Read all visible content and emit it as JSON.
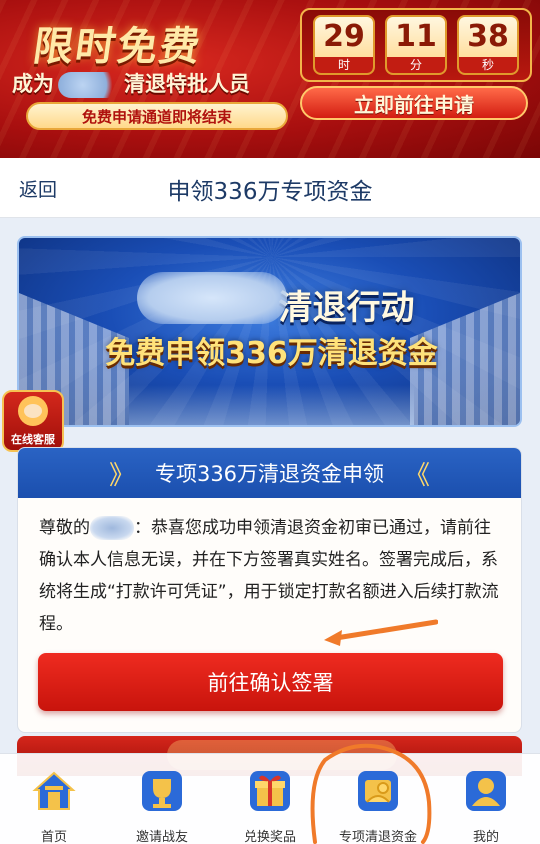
{
  "promo": {
    "title": "限时免费",
    "subtitle_prefix": "成为",
    "subtitle_suffix": "清退特批人员",
    "pill": "免费申请通道即将结束",
    "countdown": [
      {
        "value": "29",
        "unit": "时"
      },
      {
        "value": "11",
        "unit": "分"
      },
      {
        "value": "38",
        "unit": "秒"
      }
    ],
    "cta": "立即前往申请"
  },
  "nav": {
    "back": "返回",
    "title": "申领336万专项资金"
  },
  "hero": {
    "line1": "清退行动",
    "line2": "免费申领336万清退资金"
  },
  "service": {
    "label": "在线客服"
  },
  "card": {
    "title": "专项336万清退资金申领",
    "chevron_left": "》",
    "chevron_right": "《",
    "greeting": "尊敬的",
    "body": "：恭喜您成功申领清退资金初审已通过，请前往确认本人信息无误，并在下方签署真实姓名。签署完成后，系统将生成“打款许可凭证”，用于锁定打款名额进入后续打款流程。",
    "button": "前往确认签署"
  },
  "tabs": [
    {
      "label": "首页",
      "icon": "home-icon"
    },
    {
      "label": "邀请战友",
      "icon": "trophy-icon"
    },
    {
      "label": "兑换奖品",
      "icon": "gift-icon"
    },
    {
      "label": "专项清退资金",
      "icon": "fund-icon"
    },
    {
      "label": "我的",
      "icon": "user-icon"
    }
  ],
  "colors": {
    "accent_red": "#d31d12",
    "nav_blue": "#1d3a66",
    "card_blue": "#2a63c4",
    "gold": "#ffd86a",
    "annotation_orange": "#f07a2a"
  }
}
